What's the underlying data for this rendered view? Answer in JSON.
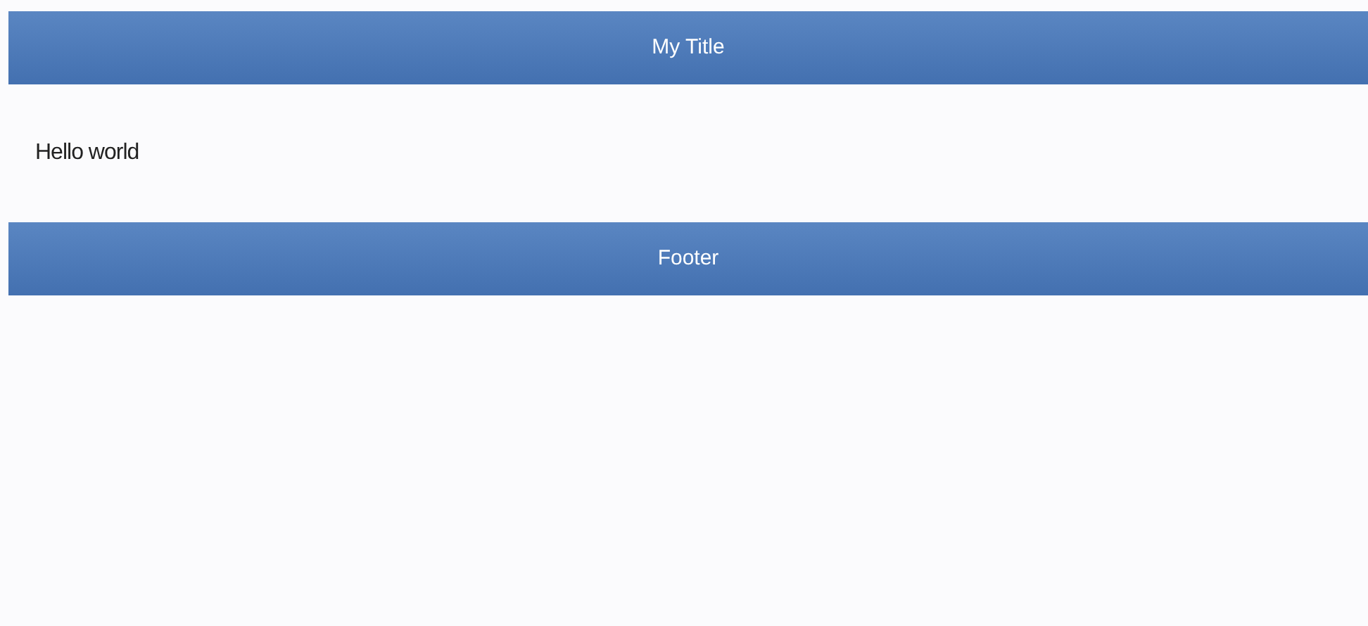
{
  "header": {
    "title": "My Title"
  },
  "content": {
    "text": "Hello world"
  },
  "footer": {
    "text": "Footer"
  }
}
